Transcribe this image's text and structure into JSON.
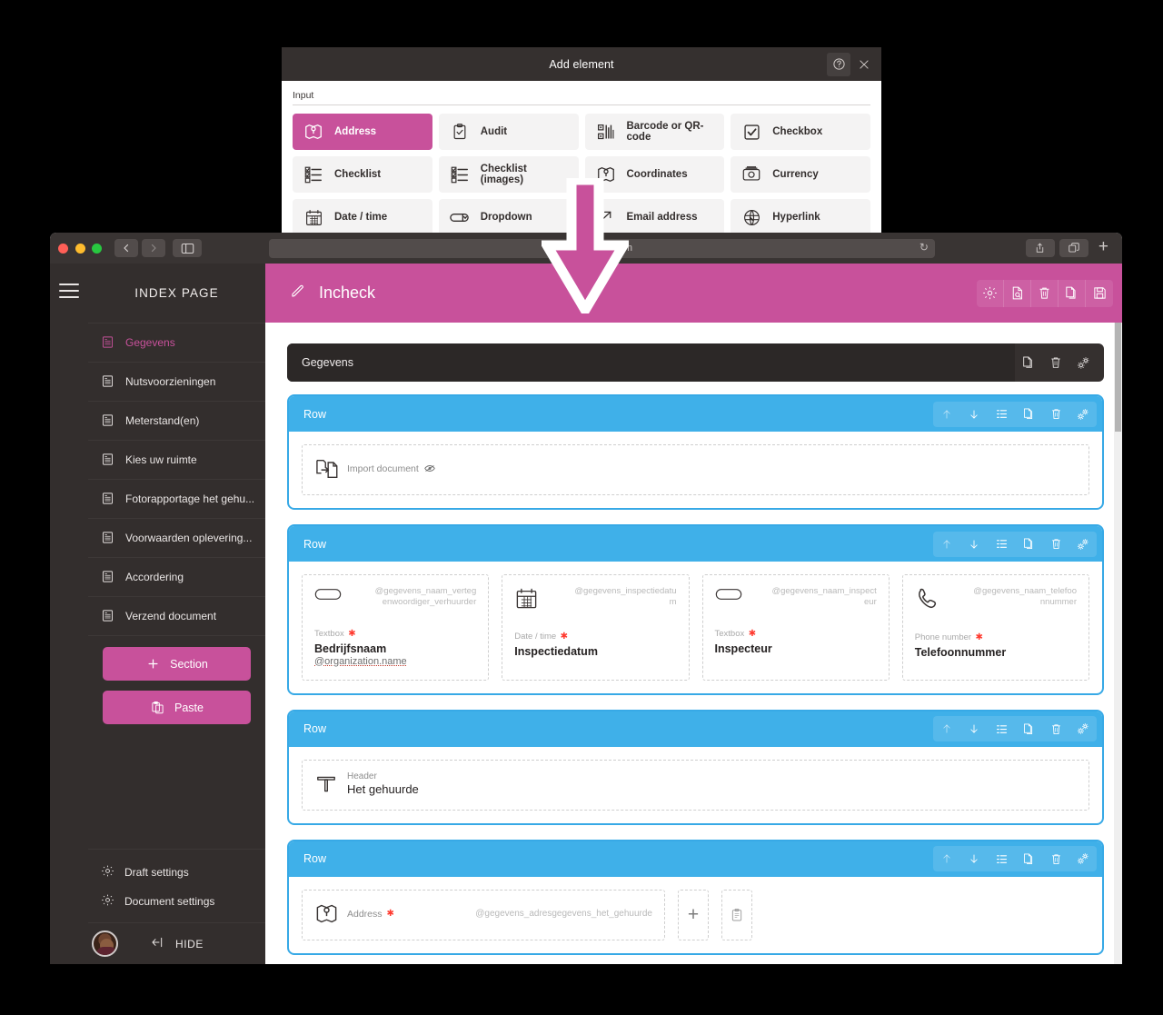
{
  "modal": {
    "title": "Add element",
    "help_icon": "question-mark-circle-icon",
    "close_icon": "close-icon",
    "section_label": "Input",
    "selected_color": "#c8519b",
    "elements": [
      {
        "label": "Address",
        "icon": "map-pin-icon",
        "selected": true
      },
      {
        "label": "Audit",
        "icon": "clipboard-check-icon",
        "selected": false
      },
      {
        "label": "Barcode or QR-code",
        "icon": "barcode-icon",
        "selected": false
      },
      {
        "label": "Checkbox",
        "icon": "checkbox-icon",
        "selected": false
      },
      {
        "label": "Checklist",
        "icon": "checklist-icon",
        "selected": false
      },
      {
        "label": "Checklist (images)",
        "icon": "checklist-images-icon",
        "selected": false
      },
      {
        "label": "Coordinates",
        "icon": "map-pin-icon",
        "selected": false
      },
      {
        "label": "Currency",
        "icon": "money-icon",
        "selected": false
      },
      {
        "label": "Date / time",
        "icon": "calendar-icon",
        "selected": false
      },
      {
        "label": "Dropdown",
        "icon": "dropdown-icon",
        "selected": false
      },
      {
        "label": "Email address",
        "icon": "email-arrow-icon",
        "selected": false
      },
      {
        "label": "Hyperlink",
        "icon": "globe-link-icon",
        "selected": false
      }
    ]
  },
  "browser": {
    "url": "po…ll.com",
    "lock_icon": "lock-icon",
    "reload_icon": "reload-icon",
    "back_icon": "chevron-left-icon",
    "forward_icon": "chevron-right-icon",
    "sidebar_icon": "sidebar-toggle-icon",
    "reader_icon": "reader-view-icon",
    "share_icon": "share-icon",
    "tabs_icon": "tab-overview-icon",
    "new_tab_label": "+"
  },
  "sidebar": {
    "menu_icon": "hamburger-menu-icon",
    "heading": "INDEX PAGE",
    "items": [
      {
        "label": "Gegevens",
        "active": true
      },
      {
        "label": "Nutsvoorzieningen",
        "active": false
      },
      {
        "label": "Meterstand(en)",
        "active": false
      },
      {
        "label": "Kies uw ruimte",
        "active": false
      },
      {
        "label": "Fotorapportage het gehu...",
        "active": false
      },
      {
        "label": "Voorwaarden oplevering...",
        "active": false
      },
      {
        "label": "Accordering",
        "active": false
      },
      {
        "label": "Verzend document",
        "active": false
      }
    ],
    "buttons": [
      {
        "label": "Section",
        "icon": "plus-icon"
      },
      {
        "label": "Paste",
        "icon": "clipboard-paste-icon"
      }
    ],
    "settings": [
      {
        "label": "Draft settings",
        "icon": "gear-icon"
      },
      {
        "label": "Document settings",
        "icon": "gear-icon"
      }
    ],
    "hide_label": "HIDE",
    "hide_icon": "collapse-left-icon",
    "avatar": "user-avatar",
    "accent_color": "#c8519b"
  },
  "topbar": {
    "title": "Incheck",
    "edit_icon": "pencil-icon",
    "tools": [
      {
        "icon": "gear-icon",
        "name": "settings-button"
      },
      {
        "icon": "document-search-icon",
        "name": "preview-button"
      },
      {
        "icon": "trash-icon",
        "name": "delete-button"
      },
      {
        "icon": "copy-icon",
        "name": "duplicate-button"
      },
      {
        "icon": "save-icon",
        "name": "save-button"
      }
    ]
  },
  "section": {
    "name": "Gegevens",
    "tools": [
      {
        "icon": "copy-icon",
        "name": "section-duplicate-button"
      },
      {
        "icon": "trash-icon",
        "name": "section-delete-button"
      },
      {
        "icon": "gears-icon",
        "name": "section-settings-button"
      }
    ]
  },
  "row_tools": [
    {
      "icon": "arrow-up-icon",
      "name": "move-up-button",
      "dim": true
    },
    {
      "icon": "arrow-down-icon",
      "name": "move-down-button",
      "dim": false
    },
    {
      "icon": "list-icon",
      "name": "row-layout-button",
      "dim": false
    },
    {
      "icon": "copy-icon",
      "name": "row-duplicate-button",
      "dim": false
    },
    {
      "icon": "trash-icon",
      "name": "row-delete-button",
      "dim": false
    },
    {
      "icon": "gears-icon",
      "name": "row-settings-button",
      "dim": false
    }
  ],
  "rows": [
    {
      "title": "Row",
      "fields": [
        {
          "kind": "inline",
          "icon": "import-document-icon",
          "type_label": "Import document",
          "eye_icon": "eye-hidden-icon"
        }
      ]
    },
    {
      "title": "Row",
      "fields": [
        {
          "kind": "block",
          "icon": "textbox-icon",
          "placeholder": "@gegevens_naam_vertegenwoordiger_verhuurder",
          "type_label": "Textbox",
          "required": true,
          "label": "Bedrijfsnaam",
          "sublabel": "@organization.name"
        },
        {
          "kind": "block",
          "icon": "calendar-icon",
          "placeholder": "@gegevens_inspectiedatum",
          "type_label": "Date / time",
          "required": true,
          "label": "Inspectiedatum"
        },
        {
          "kind": "block",
          "icon": "textbox-icon",
          "placeholder": "@gegevens_naam_inspecteur",
          "type_label": "Textbox",
          "required": true,
          "label": "Inspecteur"
        },
        {
          "kind": "block",
          "icon": "phone-icon",
          "placeholder": "@gegevens_naam_telefoonnummer",
          "type_label": "Phone number",
          "required": true,
          "label": "Telefoonnummer"
        }
      ]
    },
    {
      "title": "Row",
      "fields": [
        {
          "kind": "header",
          "icon": "text-header-icon",
          "type_label": "Header",
          "label": "Het gehuurde"
        }
      ]
    },
    {
      "title": "Row",
      "fields": [
        {
          "kind": "address",
          "icon": "map-pin-icon",
          "type_label": "Address",
          "required": true,
          "placeholder": "@gegevens_adresgegevens_het_gehuurde"
        }
      ],
      "extra_buttons": [
        {
          "icon": "plus-icon",
          "name": "add-element-button"
        },
        {
          "icon": "clipboard-paste-icon",
          "name": "paste-element-button"
        }
      ]
    }
  ],
  "colors": {
    "pink": "#c8519b",
    "blue": "#3fb0e9",
    "dark": "#332e2d",
    "required_red": "#ff3b30"
  }
}
